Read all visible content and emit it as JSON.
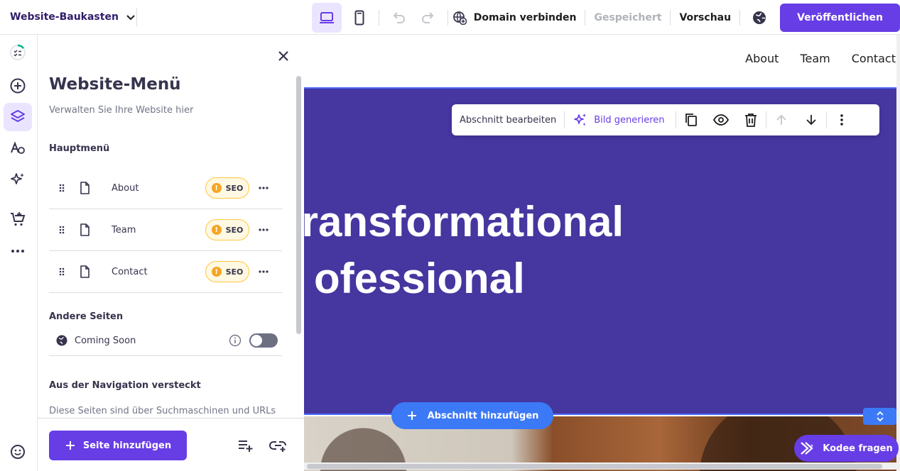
{
  "topbar": {
    "site_name": "Website-Baukasten",
    "domain_label": "Domain verbinden",
    "saved_label": "Gespeichert",
    "preview_label": "Vorschau",
    "publish_label": "Veröffentlichen"
  },
  "panel": {
    "title": "Website-Menü",
    "subtitle": "Verwalten Sie Ihre Website hier",
    "main_menu_label": "Hauptmenü",
    "pages": [
      {
        "name": "About",
        "badge": "SEO"
      },
      {
        "name": "Team",
        "badge": "SEO"
      },
      {
        "name": "Contact",
        "badge": "SEO"
      }
    ],
    "other_pages_label": "Andere Seiten",
    "other_pages": [
      {
        "name": "Coming Soon"
      }
    ],
    "hidden_label": "Aus der Navigation versteckt",
    "hidden_desc": "Diese Seiten sind über Suchmaschinen und URLs",
    "add_page_label": "Seite hinzufügen"
  },
  "canvas": {
    "nav": [
      "About",
      "Team",
      "Contact"
    ],
    "hero_line1": " transformational",
    "hero_line2": "ofessional",
    "toolbar": {
      "edit_label": "Abschnitt bearbeiten",
      "generate_label": "Bild generieren"
    },
    "add_section_label": "Abschnitt hinzufügen"
  },
  "assistant": {
    "label": "Kodee fragen"
  },
  "colors": {
    "accent": "#673de6",
    "hero_bg": "#4536a0",
    "blue": "#3c79f7"
  }
}
